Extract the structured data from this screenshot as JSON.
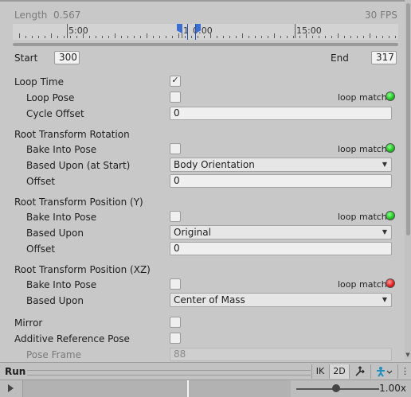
{
  "clip": {
    "length_label": "Length",
    "length_value": "0.567",
    "fps": "30 FPS",
    "timeline_labels": [
      "5:00",
      "1",
      "0:00",
      "15:00"
    ],
    "start_label": "Start",
    "start_value": "300",
    "end_label": "End",
    "end_value": "317"
  },
  "loop_time": {
    "label": "Loop Time",
    "checked": true
  },
  "loop_pose": {
    "label": "Loop Pose",
    "match_label": "loop match",
    "status": "green"
  },
  "cycle_offset": {
    "label": "Cycle Offset",
    "value": "0"
  },
  "rotation": {
    "title": "Root Transform Rotation",
    "bake_label": "Bake Into Pose",
    "match_label": "loop match",
    "status": "green",
    "based_label": "Based Upon (at Start)",
    "based_value": "Body Orientation",
    "offset_label": "Offset",
    "offset_value": "0"
  },
  "position_y": {
    "title": "Root Transform Position (Y)",
    "bake_label": "Bake Into Pose",
    "match_label": "loop match",
    "status": "green",
    "based_label": "Based Upon",
    "based_value": "Original",
    "offset_label": "Offset",
    "offset_value": "0"
  },
  "position_xz": {
    "title": "Root Transform Position (XZ)",
    "bake_label": "Bake Into Pose",
    "match_label": "loop match",
    "status": "red",
    "based_label": "Based Upon",
    "based_value": "Center of Mass"
  },
  "mirror": {
    "label": "Mirror"
  },
  "additive": {
    "label": "Additive Reference Pose"
  },
  "pose_frame": {
    "label": "Pose Frame",
    "value": "88"
  },
  "preview": {
    "title": "Run",
    "ik_label": "IK",
    "mode_2d_label": "2D",
    "speed_value": "1.00x",
    "speed_fraction": 0.5
  },
  "colors": {
    "accent": "#3b6fd1",
    "loop_ok": "#1cc21c",
    "loop_bad": "#e01818"
  }
}
